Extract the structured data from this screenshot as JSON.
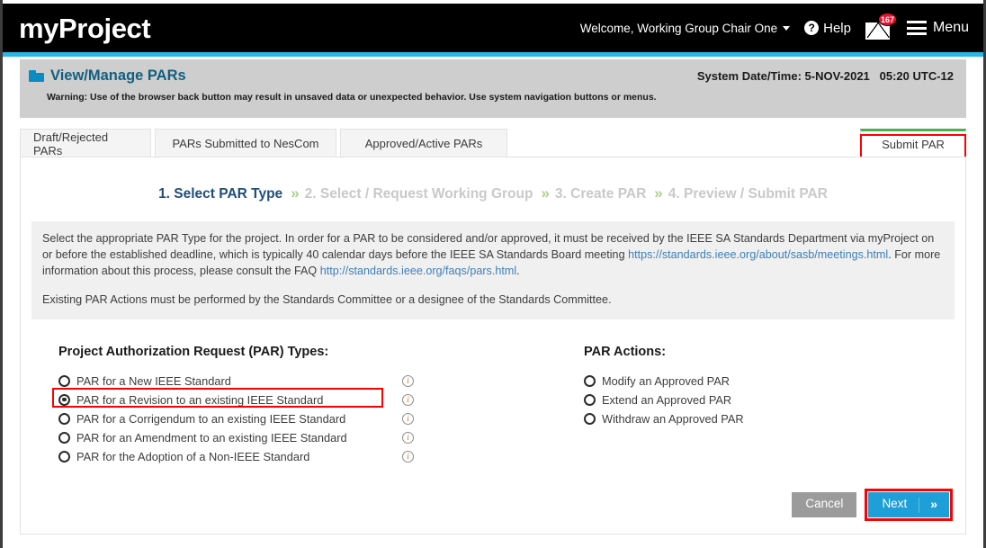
{
  "appbar": {
    "brand": "myProject",
    "welcome": "Welcome, Working Group Chair One",
    "help_label": "Help",
    "help_icon": "question-circle-icon",
    "mail_icon": "envelope-icon",
    "mail_badge": "167",
    "menu_label": "Menu",
    "menu_icon": "hamburger-icon",
    "caret_icon": "chevron-down-icon"
  },
  "subheader": {
    "folder_icon": "folder-icon",
    "title": "View/Manage PARs",
    "system_datetime": "System Date/Time: 5-NOV-2021   05:20 UTC-12",
    "warning": "Warning: Use of the browser back button may result in unsaved data or unexpected behavior. Use system navigation buttons or menus."
  },
  "tabs": [
    {
      "label": "Draft/Rejected PARs",
      "active": false
    },
    {
      "label": "PARs Submitted to NesCom",
      "active": false
    },
    {
      "label": "Approved/Active PARs",
      "active": false
    },
    {
      "label": "Submit PAR",
      "active": true
    }
  ],
  "steps": [
    {
      "label": "1. Select PAR Type",
      "state": "current"
    },
    {
      "label": "2. Select / Request Working Group",
      "state": "muted"
    },
    {
      "label": "3. Create PAR",
      "state": "muted"
    },
    {
      "label": "4. Preview / Submit PAR",
      "state": "muted"
    }
  ],
  "step_separator": "»",
  "infobox": {
    "p1_a": "Select the appropriate PAR Type for the project. In order for a PAR to be considered and/or approved, it must be received by the IEEE SA Standards Department via myProject on or before the established deadline, which is typically 40 calendar days before the IEEE SA Standards Board meeting ",
    "p1_link1": "https://standards.ieee.org/about/sasb/meetings.html",
    "p1_b": ". For more information about this process, please consult the FAQ ",
    "p1_link2": "http://standards.ieee.org/faqs/pars.html",
    "p1_c": ".",
    "p2": "Existing PAR Actions must be performed by the Standards Committee or a designee of the Standards Committee."
  },
  "par_types": {
    "heading": "Project Authorization Request (PAR) Types:",
    "info_icon": "info-circle-icon",
    "options": [
      {
        "label": "PAR for a New IEEE Standard",
        "selected": false
      },
      {
        "label": "PAR for a Revision to an existing IEEE Standard",
        "selected": true
      },
      {
        "label": "PAR for a Corrigendum to an existing IEEE Standard",
        "selected": false
      },
      {
        "label": "PAR for an Amendment to an existing IEEE Standard",
        "selected": false
      },
      {
        "label": "PAR for the Adoption of a Non-IEEE Standard",
        "selected": false
      }
    ]
  },
  "par_actions": {
    "heading": "PAR Actions:",
    "options": [
      {
        "label": "Modify an Approved PAR",
        "selected": false
      },
      {
        "label": "Extend an Approved PAR",
        "selected": false
      },
      {
        "label": "Withdraw an Approved PAR",
        "selected": false
      }
    ]
  },
  "footer": {
    "cancel_label": "Cancel",
    "next_label": "Next",
    "next_arrow": "»"
  },
  "colors": {
    "appbar_bg": "#000000",
    "accent_cyan": "#29b8e5",
    "subheader_bg": "#cecece",
    "title_blue": "#125f7e",
    "active_tab_green": "#4fae52",
    "highlight_red": "#ff0000",
    "next_blue": "#1e9fd8",
    "cancel_gray": "#9b9b9b",
    "badge_red": "#e8112d",
    "link_blue": "#3f7fb5",
    "step_current": "#1f4e79",
    "step_muted": "#c9c9c9",
    "chevron_green": "#a9d08e"
  }
}
